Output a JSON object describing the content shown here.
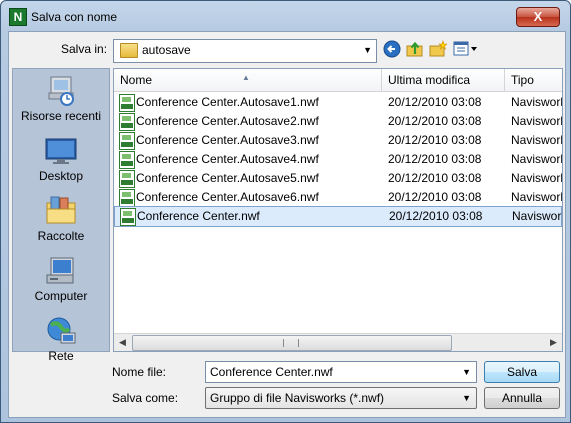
{
  "window": {
    "title": "Salva con nome",
    "app_icon_letter": "N",
    "close_symbol": "X"
  },
  "toolbar": {
    "look_in_label": "Salva in:",
    "look_in_value": "autosave",
    "icons": [
      "back-icon",
      "up-folder-icon",
      "new-folder-icon",
      "view-menu-icon"
    ]
  },
  "places": [
    {
      "label": "Risorse recenti",
      "icon": "recent-places-icon"
    },
    {
      "label": "Desktop",
      "icon": "desktop-icon"
    },
    {
      "label": "Raccolte",
      "icon": "libraries-icon"
    },
    {
      "label": "Computer",
      "icon": "computer-icon"
    },
    {
      "label": "Rete",
      "icon": "network-icon"
    }
  ],
  "filelist": {
    "columns": [
      "Nome",
      "Ultima modifica",
      "Tipo"
    ],
    "rows": [
      {
        "name": "Conference Center.Autosave1.nwf",
        "date": "20/12/2010 03:08",
        "type": "Navisworks"
      },
      {
        "name": "Conference Center.Autosave2.nwf",
        "date": "20/12/2010 03:08",
        "type": "Navisworks"
      },
      {
        "name": "Conference Center.Autosave3.nwf",
        "date": "20/12/2010 03:08",
        "type": "Navisworks"
      },
      {
        "name": "Conference Center.Autosave4.nwf",
        "date": "20/12/2010 03:08",
        "type": "Navisworks"
      },
      {
        "name": "Conference Center.Autosave5.nwf",
        "date": "20/12/2010 03:08",
        "type": "Navisworks"
      },
      {
        "name": "Conference Center.Autosave6.nwf",
        "date": "20/12/2010 03:08",
        "type": "Navisworks"
      },
      {
        "name": "Conference Center.nwf",
        "date": "20/12/2010 03:08",
        "type": "Navisworks",
        "selected": true
      }
    ]
  },
  "form": {
    "filename_label": "Nome file:",
    "filename_value": "Conference Center.nwf",
    "filetype_label": "Salva come:",
    "filetype_value": "Gruppo di file Navisworks (*.nwf)"
  },
  "buttons": {
    "save": "Salva",
    "cancel": "Annulla"
  },
  "colors": {
    "selection": "#dcebfc",
    "nwf_icon": "#2e7d32"
  }
}
